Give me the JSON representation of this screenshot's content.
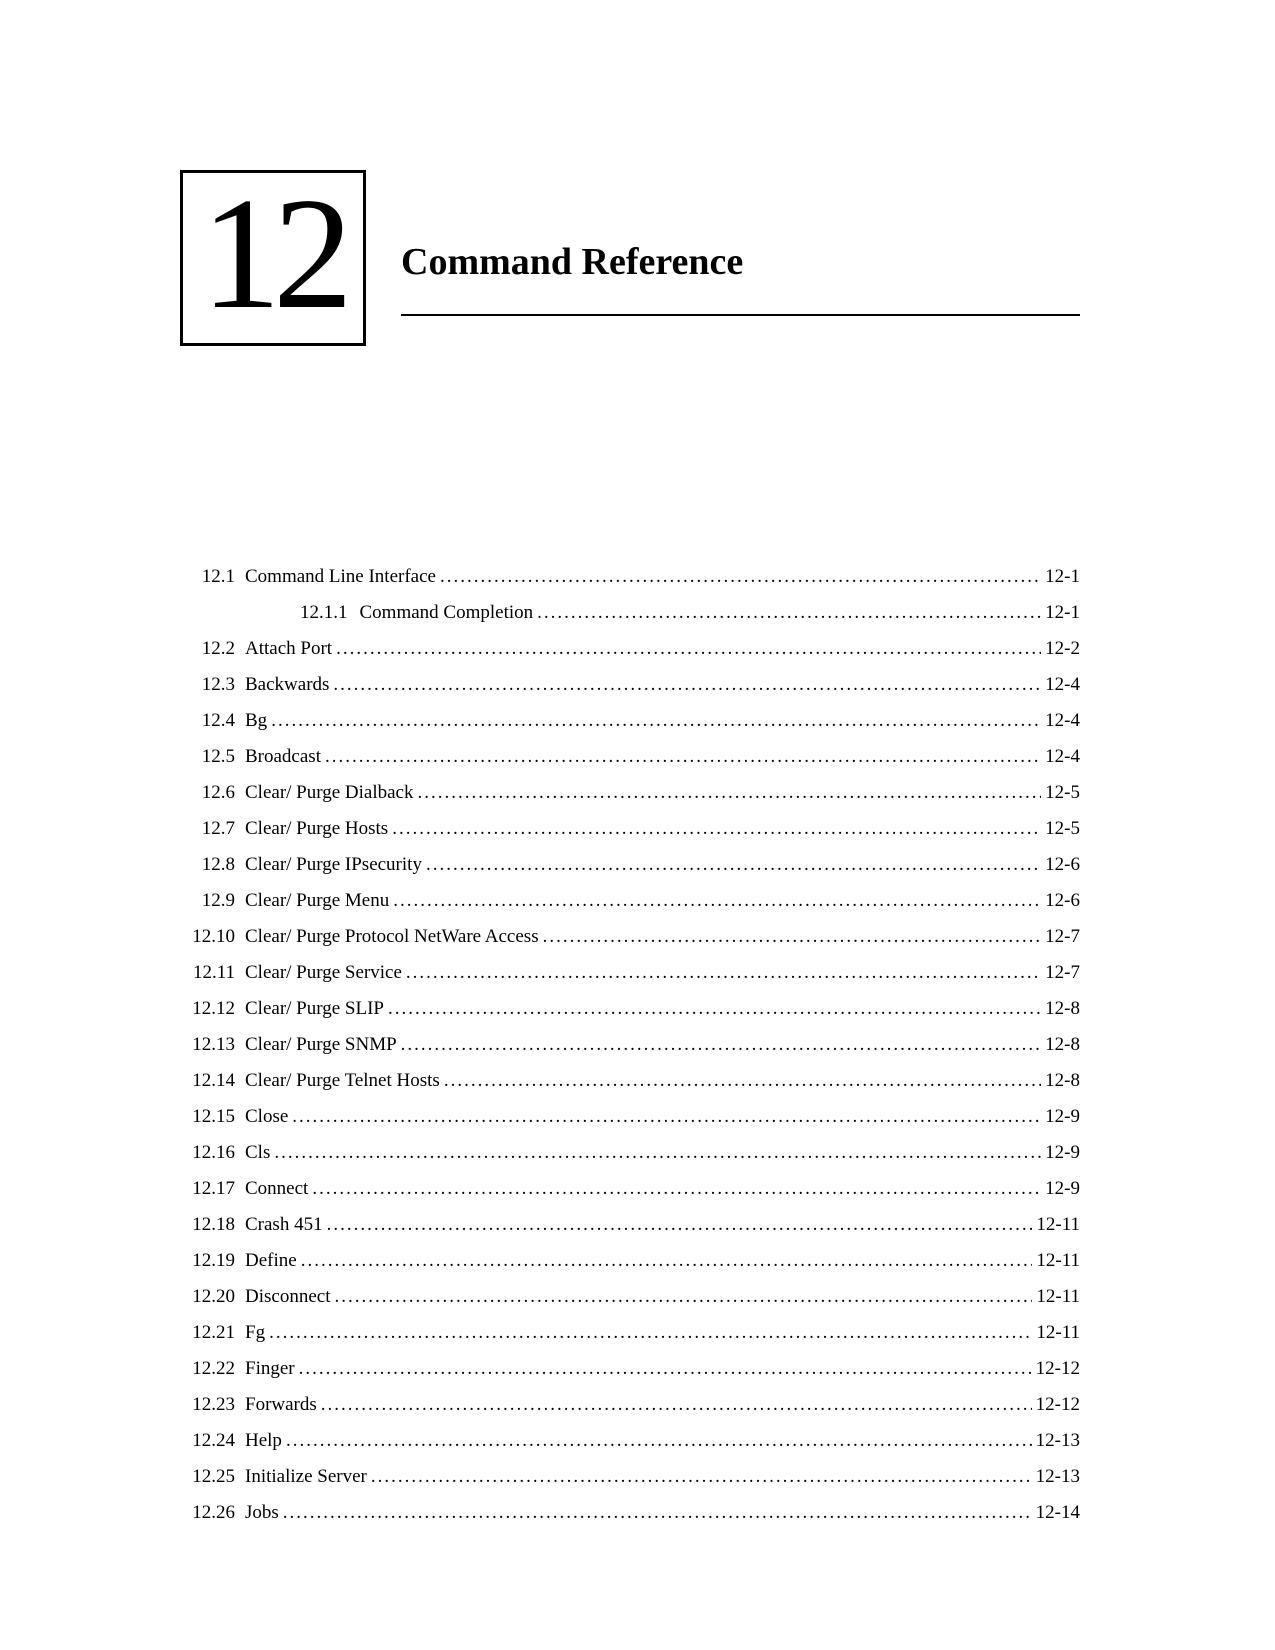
{
  "chapter_number": "12",
  "chapter_title": "Command Reference",
  "toc": [
    {
      "num": "12.1",
      "title": "Command Line Interface",
      "page": "12-1",
      "sub": false
    },
    {
      "num": "12.1.1",
      "title": "Command Completion",
      "page": "12-1",
      "sub": true
    },
    {
      "num": "12.2",
      "title": "Attach Port",
      "page": "12-2",
      "sub": false
    },
    {
      "num": "12.3",
      "title": "Backwards",
      "page": "12-4",
      "sub": false
    },
    {
      "num": "12.4",
      "title": "Bg",
      "page": "12-4",
      "sub": false
    },
    {
      "num": "12.5",
      "title": "Broadcast",
      "page": "12-4",
      "sub": false
    },
    {
      "num": "12.6",
      "title": "Clear/ Purge Dialback",
      "page": "12-5",
      "sub": false
    },
    {
      "num": "12.7",
      "title": "Clear/ Purge Hosts",
      "page": "12-5",
      "sub": false
    },
    {
      "num": "12.8",
      "title": "Clear/ Purge IPsecurity",
      "page": "12-6",
      "sub": false
    },
    {
      "num": "12.9",
      "title": "Clear/ Purge Menu",
      "page": "12-6",
      "sub": false
    },
    {
      "num": "12.10",
      "title": "Clear/ Purge Protocol NetWare Access",
      "page": "12-7",
      "sub": false
    },
    {
      "num": "12.11",
      "title": "Clear/ Purge Service",
      "page": "12-7",
      "sub": false
    },
    {
      "num": "12.12",
      "title": "Clear/ Purge SLIP",
      "page": "12-8",
      "sub": false
    },
    {
      "num": "12.13",
      "title": "Clear/ Purge SNMP",
      "page": "12-8",
      "sub": false
    },
    {
      "num": "12.14",
      "title": "Clear/ Purge Telnet Hosts",
      "page": "12-8",
      "sub": false
    },
    {
      "num": "12.15",
      "title": "Close",
      "page": "12-9",
      "sub": false
    },
    {
      "num": "12.16",
      "title": "Cls",
      "page": "12-9",
      "sub": false
    },
    {
      "num": "12.17",
      "title": "Connect",
      "page": "12-9",
      "sub": false
    },
    {
      "num": "12.18",
      "title": "Crash 451",
      "page": "12-11",
      "sub": false
    },
    {
      "num": "12.19",
      "title": "Define",
      "page": "12-11",
      "sub": false
    },
    {
      "num": "12.20",
      "title": "Disconnect",
      "page": "12-11",
      "sub": false
    },
    {
      "num": "12.21",
      "title": "Fg",
      "page": "12-11",
      "sub": false
    },
    {
      "num": "12.22",
      "title": "Finger",
      "page": "12-12",
      "sub": false
    },
    {
      "num": "12.23",
      "title": "Forwards",
      "page": "12-12",
      "sub": false
    },
    {
      "num": "12.24",
      "title": "Help",
      "page": "12-13",
      "sub": false
    },
    {
      "num": "12.25",
      "title": "Initialize Server",
      "page": "12-13",
      "sub": false
    },
    {
      "num": "12.26",
      "title": "Jobs",
      "page": "12-14",
      "sub": false
    }
  ]
}
